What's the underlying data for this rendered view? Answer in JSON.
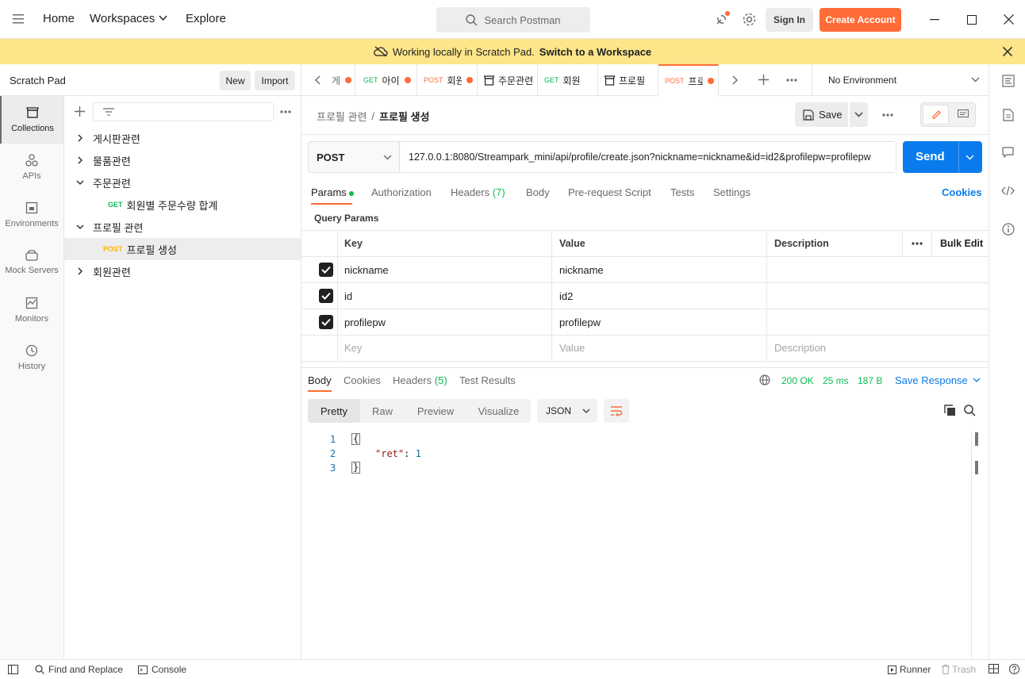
{
  "titlebar": {
    "home": "Home",
    "workspaces": "Workspaces",
    "explore": "Explore",
    "search_placeholder": "Search Postman",
    "sign_in": "Sign In",
    "create_account": "Create Account"
  },
  "banner": {
    "text": "Working locally in Scratch Pad.",
    "link": "Switch to a Workspace"
  },
  "sidebar": {
    "title": "Scratch Pad",
    "new_label": "New",
    "import_label": "Import",
    "icons": [
      {
        "label": "Collections",
        "icon": "collections-icon"
      },
      {
        "label": "APIs",
        "icon": "apis-icon"
      },
      {
        "label": "Environments",
        "icon": "environments-icon"
      },
      {
        "label": "Mock Servers",
        "icon": "mock-servers-icon"
      },
      {
        "label": "Monitors",
        "icon": "monitors-icon"
      },
      {
        "label": "History",
        "icon": "history-icon"
      }
    ],
    "tree": [
      {
        "label": "게시판관련",
        "state": "collapsed"
      },
      {
        "label": "물품관련",
        "state": "collapsed"
      },
      {
        "label": "주문관련",
        "state": "expanded"
      },
      {
        "label": "회원별 주문수량 합계",
        "method": "GET",
        "child": true
      },
      {
        "label": "프로필 관련",
        "state": "expanded"
      },
      {
        "label": "프로필 생성",
        "method": "POST",
        "child": true,
        "selected": true
      },
      {
        "label": "회원관련",
        "state": "collapsed"
      }
    ]
  },
  "tabs": [
    {
      "method": "",
      "label": "게",
      "dot": true
    },
    {
      "method": "GET",
      "label": "아이",
      "dot": true
    },
    {
      "method": "POST",
      "label": "회원",
      "dot": true
    },
    {
      "method": "",
      "label": "주문관련",
      "dot": false,
      "icon": "collection"
    },
    {
      "method": "GET",
      "label": "회원",
      "dot": false
    },
    {
      "method": "",
      "label": "프로필",
      "dot": false,
      "icon": "collection"
    },
    {
      "method": "POST",
      "label": "프로",
      "dot": true,
      "active": true
    }
  ],
  "environment": "No Environment",
  "request": {
    "breadcrumb_parent": "프로필 관련",
    "breadcrumb_sep": "/",
    "breadcrumb_current": "프로필 생성",
    "save_label": "Save",
    "method": "POST",
    "url": "127.0.0.1:8080/Streampark_mini/api/profile/create.json?nickname=nickname&id=id2&profilepw=profilepw",
    "send_label": "Send",
    "tabs": [
      "Params",
      "Authorization",
      "Headers",
      "Body",
      "Pre-request Script",
      "Tests",
      "Settings"
    ],
    "headers_count": "(7)",
    "cookies_label": "Cookies",
    "query_params_label": "Query Params",
    "columns": [
      "Key",
      "Value",
      "Description"
    ],
    "bulk_edit": "Bulk Edit",
    "params": [
      {
        "key": "nickname",
        "value": "nickname",
        "checked": true
      },
      {
        "key": "id",
        "value": "id2",
        "checked": true
      },
      {
        "key": "profilepw",
        "value": "profilepw",
        "checked": true
      }
    ],
    "placeholder_key": "Key",
    "placeholder_value": "Value",
    "placeholder_description": "Description"
  },
  "response": {
    "tabs": [
      "Body",
      "Cookies",
      "Headers",
      "Test Results"
    ],
    "headers_count": "(5)",
    "status": "200 OK",
    "time": "25 ms",
    "size": "187 B",
    "save_response": "Save Response",
    "views": [
      "Pretty",
      "Raw",
      "Preview",
      "Visualize"
    ],
    "format": "JSON",
    "lines": [
      {
        "n": "1",
        "text": "{"
      },
      {
        "n": "2",
        "key": "\"ret\"",
        "colon": ": ",
        "value": "1"
      },
      {
        "n": "3",
        "text": "}"
      }
    ]
  },
  "statusbar": {
    "find_replace": "Find and Replace",
    "console": "Console",
    "runner": "Runner",
    "trash": "Trash"
  },
  "colors": {
    "accent": "#ff6c37",
    "send_blue": "#097bed",
    "get_green": "#0cbb52",
    "post_yellow": "#ffb400",
    "banner": "#fde58a"
  }
}
